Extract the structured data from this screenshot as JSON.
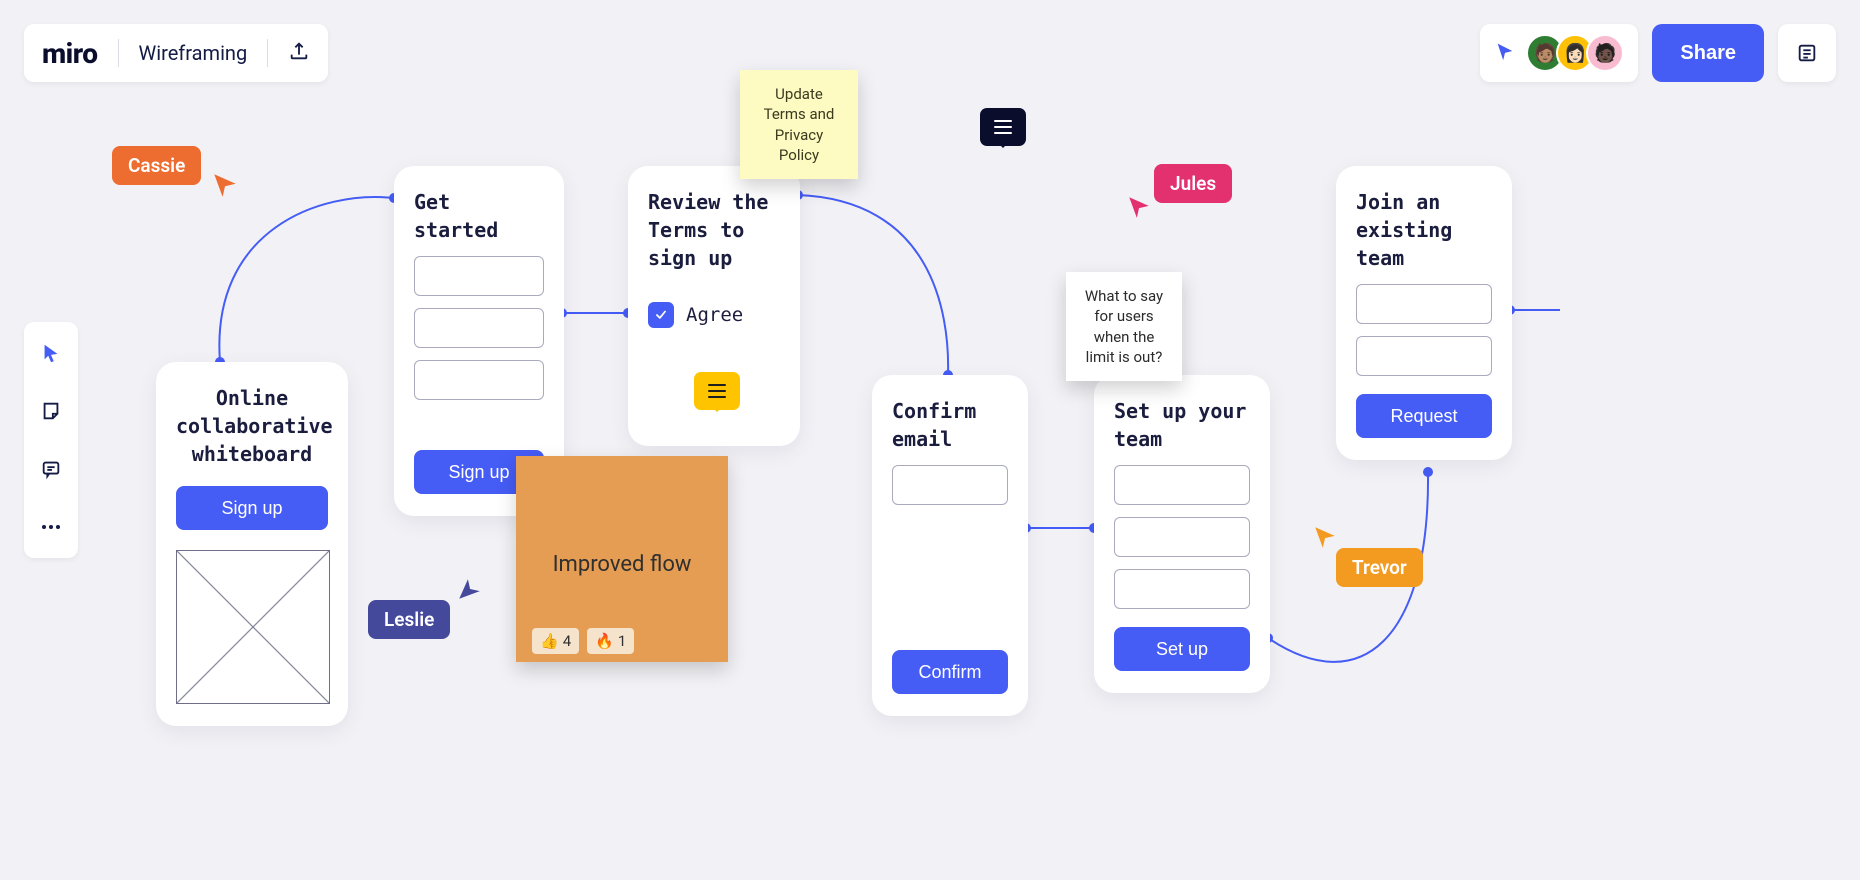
{
  "brand": "miro",
  "board_name": "Wireframing",
  "share_label": "Share",
  "cursors": {
    "cassie": "Cassie",
    "leslie": "Leslie",
    "jules": "Jules",
    "trevor": "Trevor"
  },
  "cards": {
    "welcome": {
      "title": "Online collaborative whiteboard",
      "cta": "Sign up"
    },
    "get_started": {
      "title": "Get started",
      "cta": "Sign up"
    },
    "review_terms": {
      "title": "Review the Terms to sign up",
      "agree_label": "Agree"
    },
    "confirm_email": {
      "title": "Confirm email",
      "cta": "Confirm"
    },
    "setup_team": {
      "title": "Set up your team",
      "cta": "Set up"
    },
    "join_team": {
      "title": "Join an existing team",
      "cta": "Request"
    }
  },
  "stickies": {
    "terms_update": "Update Terms and Privacy Policy",
    "limit_question": "What to say for users when the limit is out?",
    "improved_flow": {
      "text": "Improved flow",
      "reactions": [
        {
          "emoji": "👍",
          "count": 4
        },
        {
          "emoji": "🔥",
          "count": 1
        }
      ]
    }
  },
  "avatars": [
    {
      "bg": "#2E7D32",
      "emoji": "🧑🏽"
    },
    {
      "bg": "#FFC107",
      "emoji": "👩🏻"
    },
    {
      "bg": "#F8BBD0",
      "emoji": "🧑🏿"
    }
  ]
}
